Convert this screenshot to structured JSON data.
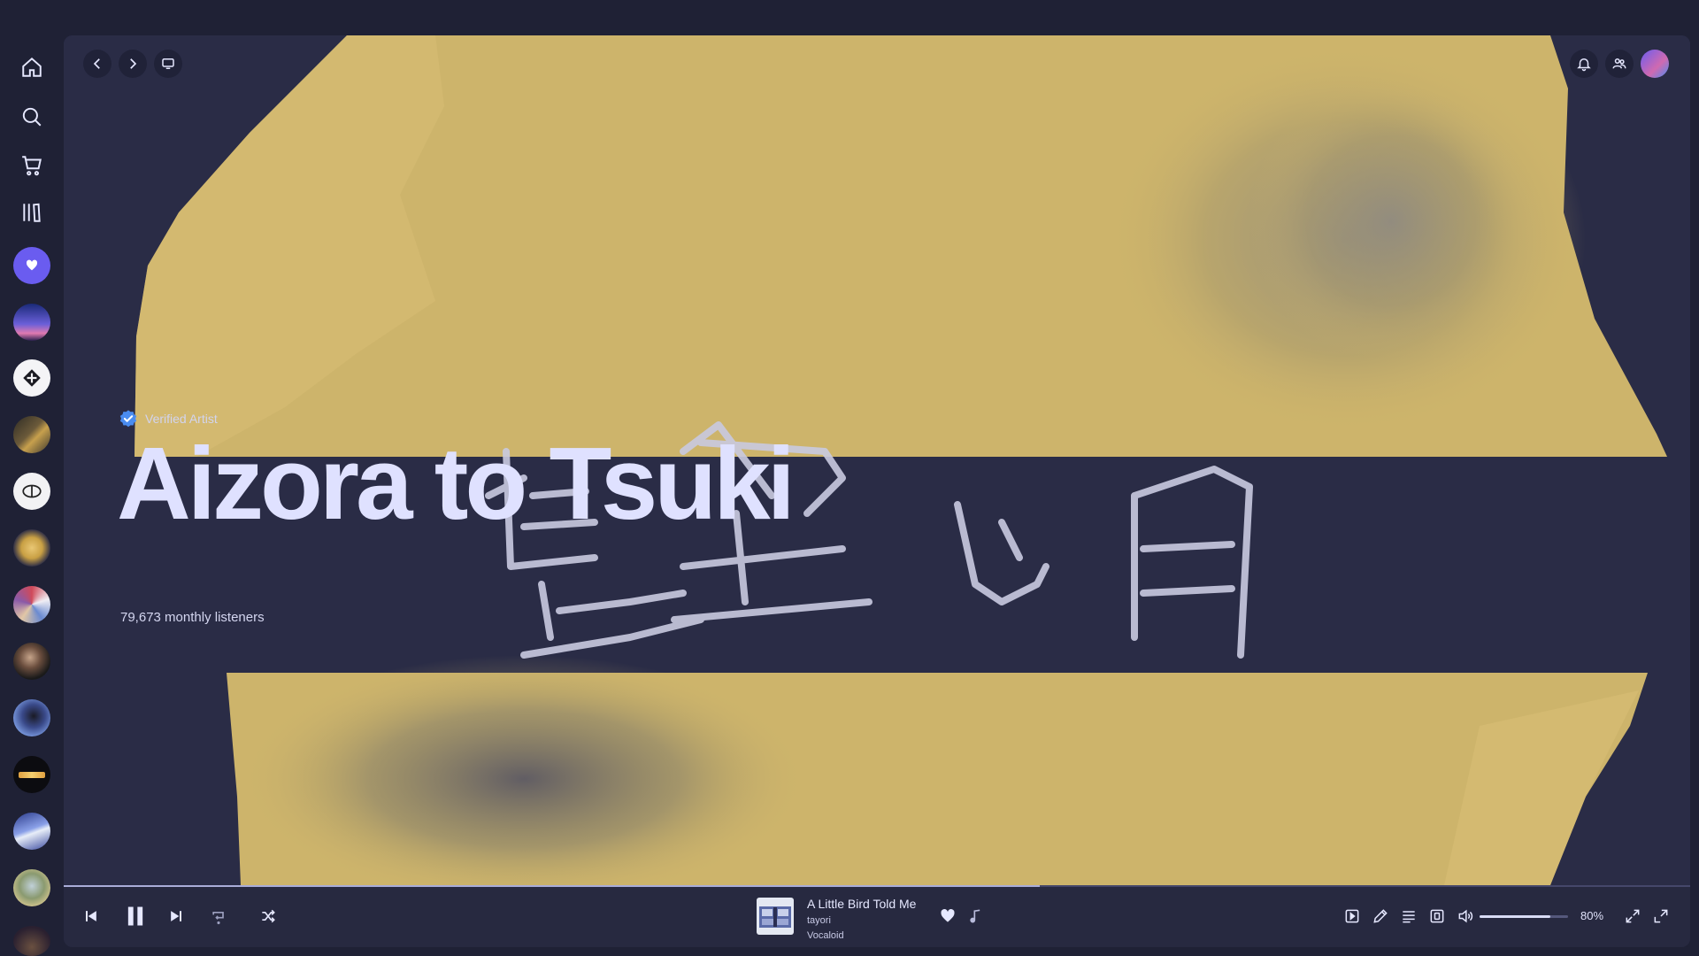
{
  "sidebar": {
    "nav": [
      {
        "name": "home",
        "icon": "home-icon"
      },
      {
        "name": "search",
        "icon": "search-icon"
      },
      {
        "name": "marketplace",
        "icon": "cart-icon"
      },
      {
        "name": "library",
        "icon": "library-icon"
      }
    ],
    "playlists": [
      {
        "name": "liked-songs",
        "icon": "heart-icon"
      },
      {
        "name": "playlist-1"
      },
      {
        "name": "playlist-2"
      },
      {
        "name": "playlist-3"
      },
      {
        "name": "playlist-4"
      },
      {
        "name": "playlist-5"
      },
      {
        "name": "playlist-6"
      },
      {
        "name": "playlist-7"
      },
      {
        "name": "playlist-8"
      },
      {
        "name": "playlist-9"
      },
      {
        "name": "playlist-10"
      },
      {
        "name": "playlist-11"
      }
    ]
  },
  "topbar": {
    "back_icon": "chevron-left-icon",
    "forward_icon": "chevron-right-icon",
    "display_icon": "monitor-icon",
    "notifications_icon": "bell-icon",
    "friends_icon": "users-icon"
  },
  "artist": {
    "verified_label": "Verified Artist",
    "name": "Aizora to Tsuki",
    "monthly_listeners": "79,673 monthly listeners",
    "header_image_text": "藍空と月"
  },
  "player": {
    "track_title": "A Little Bird Told Me",
    "track_artist": "tayori",
    "track_album": "Vocaloid",
    "progress_fraction": 0.6,
    "volume_percent": 80,
    "volume_label": "80%",
    "is_playing": true
  },
  "colors": {
    "background": "#1f2135",
    "hero_navy": "#2a2c46",
    "hero_gold": "#cdb46b",
    "title": "#dfe1ff",
    "verified_blue": "#4a8cf0"
  }
}
